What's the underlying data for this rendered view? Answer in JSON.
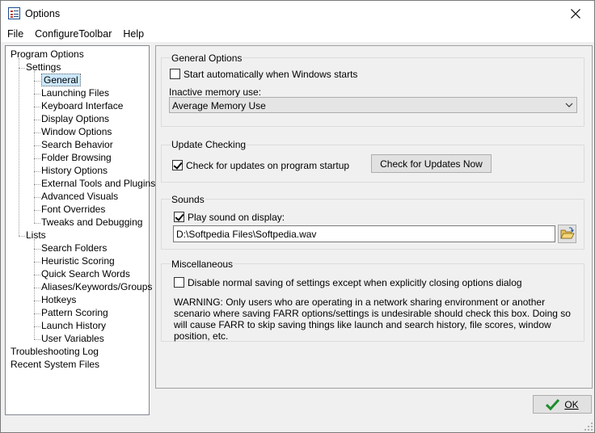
{
  "window": {
    "title": "Options",
    "close_glyph": "close-icon"
  },
  "menubar": {
    "items": [
      "File",
      "ConfigureToolbar",
      "Help"
    ]
  },
  "tree": {
    "root": "Program Options",
    "settings": "Settings",
    "settings_children": [
      "General",
      "Launching Files",
      "Keyboard Interface",
      "Display Options",
      "Window Options",
      "Search Behavior",
      "Folder Browsing",
      "History Options",
      "External Tools and Plugins",
      "Advanced Visuals",
      "Font Overrides",
      "Tweaks and Debugging"
    ],
    "lists": "Lists",
    "lists_children": [
      "Search Folders",
      "Heuristic Scoring",
      "Quick Search Words",
      "Aliases/Keywords/Groups",
      "Hotkeys",
      "Pattern Scoring",
      "Launch History",
      "User Variables"
    ],
    "troubleshooting": "Troubleshooting Log",
    "recent": "Recent System Files",
    "selected": "General"
  },
  "general": {
    "title": "General Options",
    "start_auto_label": "Start automatically when Windows starts",
    "start_auto_checked": false,
    "inactive_memory_label": "Inactive memory use:",
    "inactive_memory_value": "Average Memory Use"
  },
  "update": {
    "title": "Update Checking",
    "check_label": "Check for updates on program startup",
    "check_checked": true,
    "check_now_button": "Check for Updates Now"
  },
  "sounds": {
    "title": "Sounds",
    "play_label": "Play sound on display:",
    "play_checked": true,
    "path_value": "D:\\Softpedia Files\\Softpedia.wav"
  },
  "misc": {
    "title": "Miscellaneous",
    "disable_label": "Disable normal saving of settings except when explicitly closing options dialog",
    "disable_checked": false,
    "warning_text": "WARNING: Only users who are operating in a network sharing environment or another scenario where saving FARR options/settings is undesirable should check this box.  Doing so will cause FARR to skip saving things like launch and search history, file scores, window position, etc."
  },
  "footer": {
    "ok_label": "OK"
  }
}
